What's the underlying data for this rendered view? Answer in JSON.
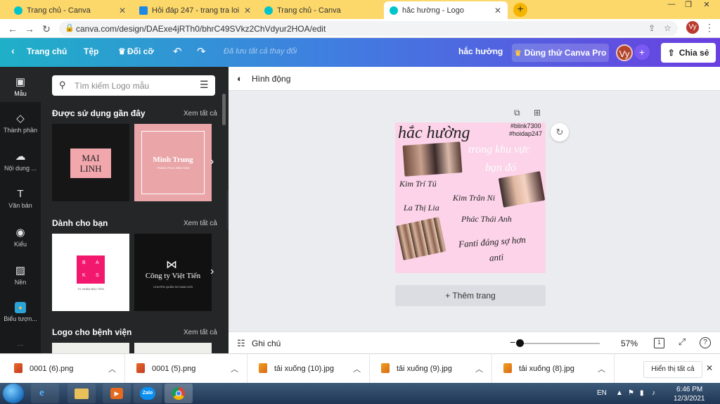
{
  "browser": {
    "tabs": [
      {
        "title": "Trang chủ - Canva",
        "active": false
      },
      {
        "title": "Hỏi đáp 247 - trang tra loi",
        "active": false
      },
      {
        "title": "Trang chủ - Canva",
        "active": false
      },
      {
        "title": "hắc hường - Logo",
        "active": true
      }
    ],
    "new_tab": "+",
    "url": "canva.com/design/DAExe4jRTh0/bhrC49SVkz2ChVdyur2HOA/edit",
    "profile": "Vy"
  },
  "header": {
    "home": "Trang chủ",
    "file": "Tệp",
    "resize": "Đổi cỡ",
    "saved_status": "Đã lưu tất cả thay đổi",
    "design_title": "hắc hường",
    "pro_button": "Dùng thử Canva Pro",
    "avatar": "Vy",
    "share": "Chia sẻ"
  },
  "rail": [
    {
      "label": "Mẫu",
      "icon": "template-icon"
    },
    {
      "label": "Thành phần",
      "icon": "elements-icon"
    },
    {
      "label": "Nội dung ...",
      "icon": "upload-icon"
    },
    {
      "label": "Văn bản",
      "icon": "text-icon"
    },
    {
      "label": "Kiểu",
      "icon": "palette-icon"
    },
    {
      "label": "Nền",
      "icon": "background-icon"
    },
    {
      "label": "Biểu tượn...",
      "icon": "logo-icon"
    }
  ],
  "panel": {
    "search_placeholder": "Tìm kiếm Logo mẫu",
    "sections": [
      {
        "title": "Được sử dụng gần đây",
        "see_all": "Xem tất cả"
      },
      {
        "title": "Dành cho bạn",
        "see_all": "Xem tất cả"
      },
      {
        "title": "Logo cho bệnh viện",
        "see_all": "Xem tất cả"
      }
    ],
    "thumbs": {
      "mai_linh_line1": "MAI",
      "mai_linh_line2": "LINH",
      "minh_trung": "Minh Trung",
      "minh_trung_sub": "TRANG PHỤC BÌNH DÂN",
      "baks": [
        "B",
        "A",
        "K",
        "S"
      ],
      "baks_sub": "TƯ NHÂN BẢU TIỀN",
      "viet_tien": "Công ty Việt Tiến",
      "viet_tien_sub": "CHUYÊN QUẦN SO NAM GIỚI"
    }
  },
  "workspace": {
    "animate": "Hình động",
    "add_page": "+ Thêm trang",
    "notes": "Ghi chú",
    "zoom": "57%",
    "page_count": "1"
  },
  "design": {
    "title": "hắc hường",
    "tag1": "#blink7300",
    "tag2": "#hoidap247",
    "white_line1": "trong khu vực",
    "white_line2": "bạn đó",
    "name1": "Kim Trí Tú",
    "name2": "Kim Trân Ni",
    "name3": "La Thị Lia",
    "name4": "Phác Thái Anh",
    "slogan1": "Fanti đáng sợ hơn",
    "slogan2": "anti"
  },
  "downloads": {
    "files": [
      {
        "name": "0001 (6).png",
        "type": "png"
      },
      {
        "name": "0001 (5).png",
        "type": "png"
      },
      {
        "name": "tải xuống (10).jpg",
        "type": "jpg"
      },
      {
        "name": "tải xuống (9).jpg",
        "type": "jpg"
      },
      {
        "name": "tải xuống (8).jpg",
        "type": "jpg"
      }
    ],
    "show_all": "Hiển thị tất cả"
  },
  "taskbar": {
    "lang": "EN",
    "time": "6:46 PM",
    "date": "12/3/2021"
  },
  "colors": {
    "tab_strip": "#fcd86a",
    "canvas_bg": "#fcd3e9",
    "panel_bg": "#252627"
  }
}
